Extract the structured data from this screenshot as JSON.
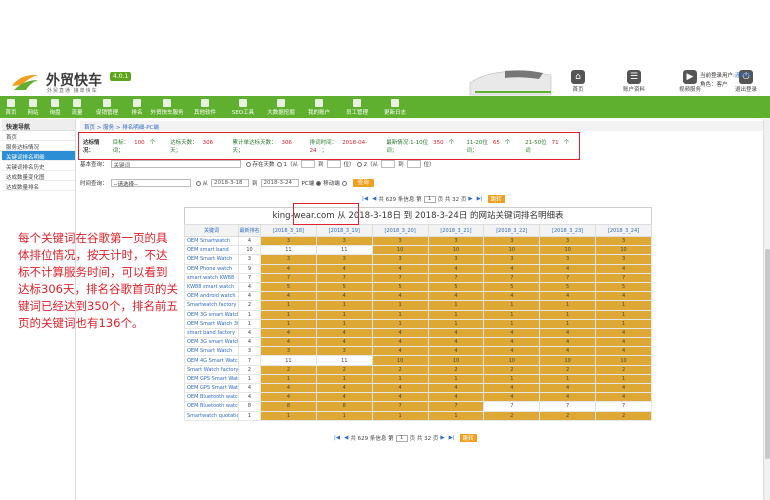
{
  "brand": {
    "name": "外贸快车",
    "version": "4.0.1",
    "slogan": "外贸直通 接单快车",
    "accent": "#5fb02e"
  },
  "top_tools": [
    {
      "label": "首页",
      "icon": "home-icon"
    },
    {
      "label": "账户资料",
      "icon": "account-icon"
    },
    {
      "label": "视频服务",
      "icon": "video-icon"
    },
    {
      "label": "退出登录",
      "icon": "power-icon"
    }
  ],
  "user": {
    "login_prefix": "当前登录用户:",
    "login_name": "连伟虎",
    "role": "角色：客户"
  },
  "nav": [
    {
      "label": "首页"
    },
    {
      "label": "网站"
    },
    {
      "label": "询盘"
    },
    {
      "label": "流量"
    },
    {
      "label": "促销管理"
    },
    {
      "label": "排名"
    },
    {
      "label": "外贸快车服务"
    },
    {
      "label": "其他软件"
    },
    {
      "label": "SEO工具"
    },
    {
      "label": "大数据挖掘"
    },
    {
      "label": "我的账户"
    },
    {
      "label": "员工管理"
    },
    {
      "label": "更新日志"
    }
  ],
  "sidebar": {
    "heading": "快速导航",
    "items": [
      {
        "label": "首页"
      },
      {
        "label": "服务达标情况"
      },
      {
        "label": "关键词排名明细"
      },
      {
        "label": "关键词排名历史"
      },
      {
        "label": "达成数量变化图"
      },
      {
        "label": "达成数量排名"
      }
    ]
  },
  "breadcrumb": "首页 > 服务 > 排名明细-PC端",
  "stats": {
    "label": "达标情况：",
    "items": [
      {
        "k": "目标：",
        "v": "100",
        "u": "个词；"
      },
      {
        "k": "达标天数：",
        "v": "306",
        "u": "天；"
      },
      {
        "k": "累计单达标天数：",
        "v": "306",
        "u": "天；"
      },
      {
        "k": "排词时间：",
        "v": "2018-04-24",
        "u": "；"
      },
      {
        "k": "最新情况:1-10位",
        "v": "350",
        "u": "个词；"
      },
      {
        "k": "11-20位",
        "v": "65",
        "u": "个词；"
      },
      {
        "k": "21-50位",
        "v": "71",
        "u": "个词"
      }
    ]
  },
  "form": {
    "basic_label": "基本查询：",
    "keyword_value": "关键词",
    "history_label": "存在天数",
    "opt1": "1（从",
    "opt1b": "到",
    "opt1c": "位）",
    "opt2": "2（从",
    "opt2b": "到",
    "opt2c": "位）",
    "time_label": "时间查询：",
    "select_value": "--请选择--",
    "from_label": "从",
    "date_from": "2018-3-18",
    "to_label": "到",
    "date_to": "2018-3-24",
    "pc_label": "PC端",
    "mobile_label": "移动端",
    "query_button": "查询"
  },
  "pager": {
    "total_top": "共 629 条信息",
    "page_label": "第",
    "page_value": "1",
    "page_of": "页 共 32 页",
    "go": "跳转",
    "total_bottom": "共 629 条信息",
    "page_of_bottom": "页 共 32 页"
  },
  "table": {
    "title_site": "king-wear.com",
    "title_rest": "从 2018-3-18日 到 2018-3-24日 的网站关键词排名明细表",
    "headers": [
      "关键词",
      "最新排名",
      "[2018_3_18]",
      "[2018_3_19]",
      "[2018_3_20]",
      "[2018_3_21]",
      "[2018_3_22]",
      "[2018_3_23]",
      "[2018_3_24]"
    ],
    "rows": [
      {
        "kw": "OEM Smartwatch",
        "latest": "4",
        "d": [
          "3",
          "3",
          "3",
          "3",
          "3",
          "3",
          "3"
        ]
      },
      {
        "kw": "OEM smart band",
        "latest": "10",
        "d": [
          "11",
          "11",
          "10",
          "10",
          "10",
          "10",
          "10"
        ]
      },
      {
        "kw": "OEM Smart Watch",
        "latest": "3",
        "d": [
          "3",
          "3",
          "3",
          "3",
          "3",
          "3",
          "3"
        ]
      },
      {
        "kw": "OEM Phone watch",
        "latest": "9",
        "d": [
          "4",
          "4",
          "4",
          "4",
          "4",
          "4",
          "4"
        ]
      },
      {
        "kw": "smart watch KW88",
        "latest": "7",
        "d": [
          "7",
          "7",
          "7",
          "7",
          "7",
          "7",
          "7"
        ]
      },
      {
        "kw": "KW88 smart watch",
        "latest": "4",
        "d": [
          "5",
          "5",
          "5",
          "5",
          "5",
          "5",
          "5"
        ]
      },
      {
        "kw": "OEM android watch",
        "latest": "4",
        "d": [
          "4",
          "4",
          "4",
          "4",
          "4",
          "4",
          "4"
        ]
      },
      {
        "kw": "Smartwatch factory",
        "latest": "2",
        "d": [
          "1",
          "1",
          "1",
          "1",
          "1",
          "1",
          "1"
        ]
      },
      {
        "kw": "OEM 3G smart Watch",
        "latest": "1",
        "d": [
          "1",
          "1",
          "1",
          "1",
          "1",
          "1",
          "1"
        ]
      },
      {
        "kw": "OEM Smart Watch 3G",
        "latest": "1",
        "d": [
          "1",
          "1",
          "1",
          "1",
          "1",
          "1",
          "1"
        ]
      },
      {
        "kw": "smart band factory",
        "latest": "4",
        "d": [
          "4",
          "4",
          "4",
          "4",
          "4",
          "4",
          "4"
        ]
      },
      {
        "kw": "OEM 3G smart Watch",
        "latest": "4",
        "d": [
          "4",
          "4",
          "4",
          "4",
          "4",
          "4",
          "4"
        ]
      },
      {
        "kw": "OEM Smart Watch",
        "latest": "3",
        "d": [
          "3",
          "3",
          "4",
          "4",
          "4",
          "4",
          "4"
        ]
      },
      {
        "kw": "OEM 4G Smart Watch",
        "latest": "7",
        "d": [
          "11",
          "11",
          "10",
          "10",
          "10",
          "10",
          "10"
        ]
      },
      {
        "kw": "Smart Watch factory",
        "latest": "2",
        "d": [
          "2",
          "2",
          "2",
          "2",
          "2",
          "2",
          "2"
        ]
      },
      {
        "kw": "OEM GPS Smart Watch",
        "latest": "1",
        "d": [
          "1",
          "1",
          "1",
          "1",
          "1",
          "1",
          "1"
        ]
      },
      {
        "kw": "OEM GPS Smart Watch",
        "latest": "4",
        "d": [
          "4",
          "4",
          "4",
          "4",
          "4",
          "4",
          "4"
        ]
      },
      {
        "kw": "OEM Bluetooth watch",
        "latest": "4",
        "d": [
          "4",
          "4",
          "4",
          "4",
          "4",
          "4",
          "4"
        ]
      },
      {
        "kw": "OEM Bluetooth watch",
        "latest": "8",
        "d": [
          "8",
          "8",
          "7",
          "7",
          "7",
          "7",
          "7"
        ]
      },
      {
        "kw": "Smartwatch quotation",
        "latest": "1",
        "d": [
          "1",
          "1",
          "1",
          "1",
          "2",
          "2",
          "2"
        ]
      }
    ],
    "white_cells": [
      [
        1,
        0
      ],
      [
        1,
        1
      ],
      [
        13,
        0
      ],
      [
        13,
        1
      ],
      [
        18,
        4
      ],
      [
        18,
        5
      ],
      [
        18,
        6
      ]
    ]
  },
  "annotation": "每个关键词在谷歌第一页的具体排位情况，按天计时，不达标不计算服务时间，可以看到达标306天，排名谷歌首页的关键词已经达到350个，排名前五页的关键词也有136个。",
  "colors": {
    "gold": "#dda934",
    "red": "#e0202a",
    "link": "#2f6ac8"
  }
}
